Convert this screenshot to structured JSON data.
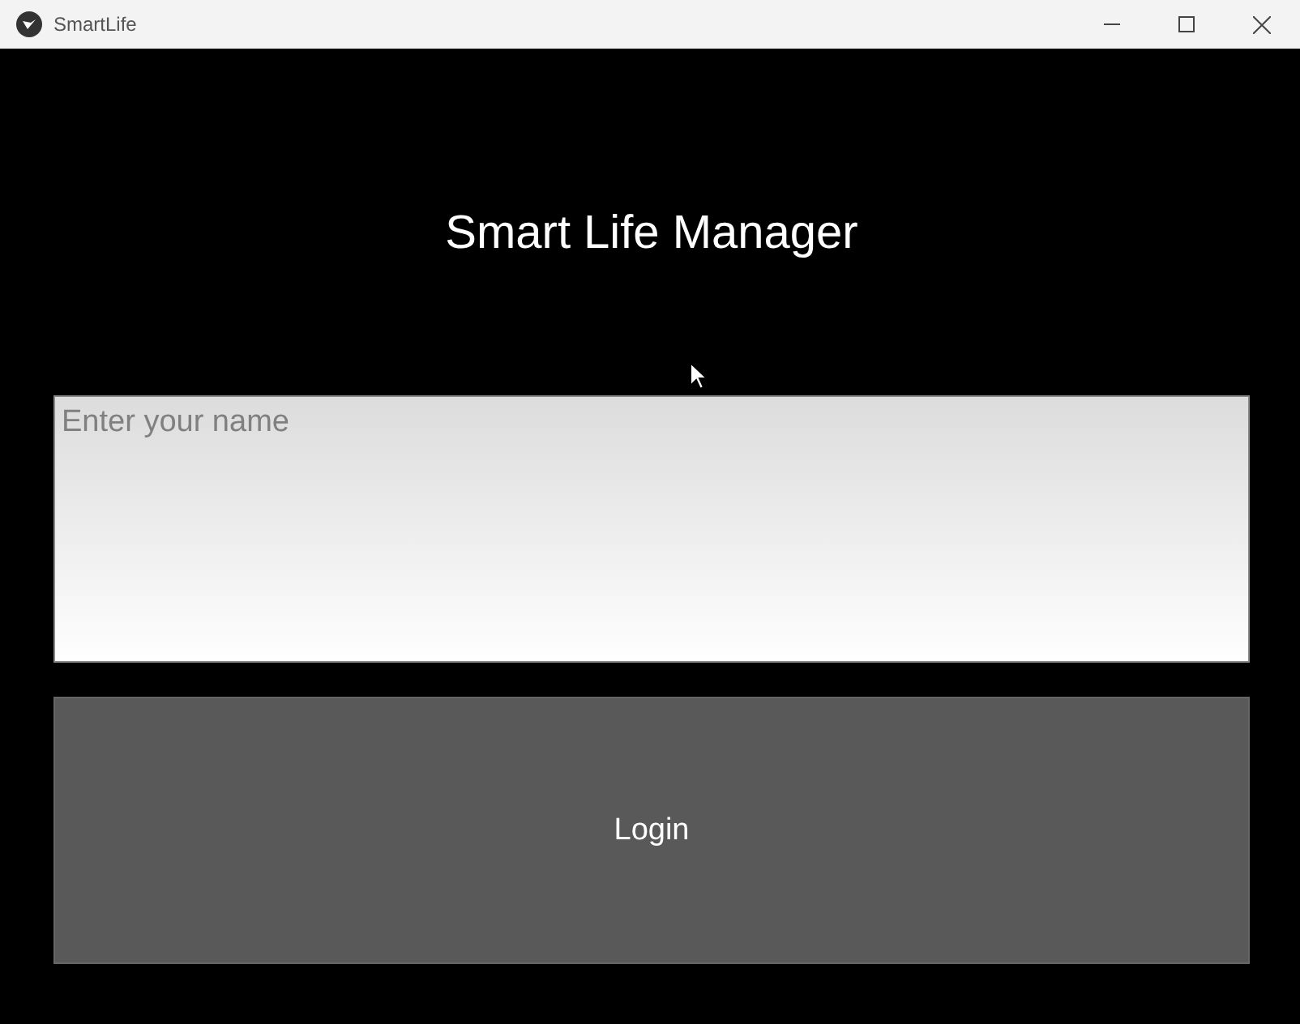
{
  "window": {
    "title": "SmartLife"
  },
  "heading": "Smart Life Manager",
  "name_field": {
    "placeholder": "Enter your name"
  },
  "login_button": {
    "label": "Login"
  }
}
